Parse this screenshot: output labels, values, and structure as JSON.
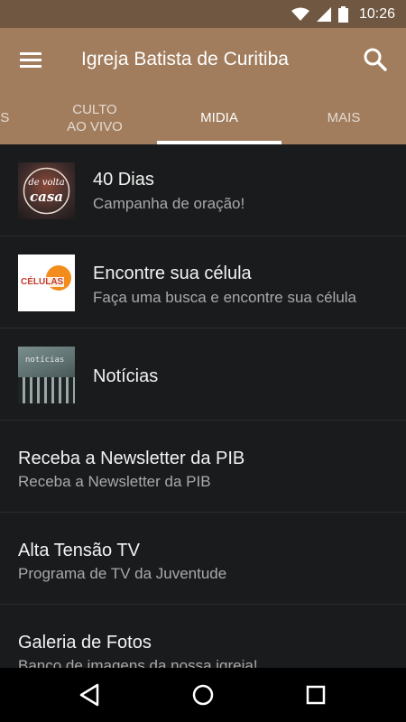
{
  "status": {
    "time": "10:26"
  },
  "app_bar": {
    "title": "Igreja Batista de Curitiba"
  },
  "tabs": [
    {
      "label": "NS"
    },
    {
      "label": "CULTO AO VIVO"
    },
    {
      "label": "MIDIA"
    },
    {
      "label": "MAIS"
    }
  ],
  "list": [
    {
      "title": "40 Dias",
      "subtitle": "Campanha de oração!",
      "thumb_text_1": "de volta",
      "thumb_text_2": "casa"
    },
    {
      "title": "Encontre sua célula",
      "subtitle": "Faça uma busca e encontre sua célula",
      "thumb_text": "CÉLULAS"
    },
    {
      "title": "Notícias",
      "thumb_text": "notícias"
    },
    {
      "title": "Receba a Newsletter da PIB",
      "subtitle": "Receba a Newsletter da PIB"
    },
    {
      "title": "Alta Tensão TV",
      "subtitle": "Programa de TV da Juventude"
    },
    {
      "title": "Galeria de Fotos",
      "subtitle": "Banco de imagens da nossa igreja!"
    }
  ],
  "colors": {
    "status_bar": "#6f5741",
    "app_bar": "#a17d5d",
    "background": "#1a1b1d",
    "accent_orange": "#f28c1d"
  },
  "icons": [
    "wifi-icon",
    "cell-signal-icon",
    "battery-icon",
    "menu-icon",
    "search-icon",
    "back-icon",
    "home-icon",
    "recents-icon"
  ]
}
